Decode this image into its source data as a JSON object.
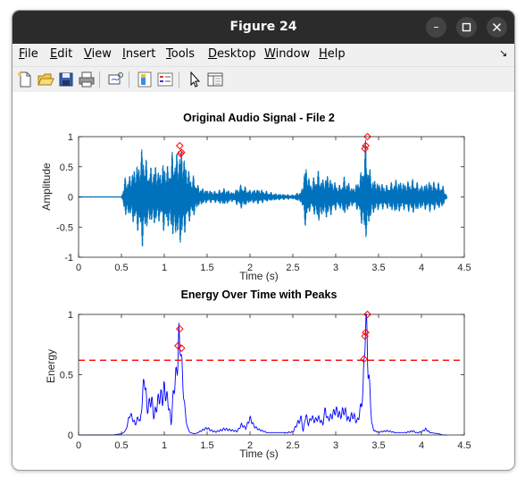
{
  "window": {
    "title": "Figure 24",
    "controls": {
      "minimize": "–",
      "maximize": "□",
      "close": "✕"
    }
  },
  "menu": {
    "items": [
      {
        "label": "File",
        "key": "F",
        "rest": "ile"
      },
      {
        "label": "Edit",
        "key": "E",
        "rest": "dit"
      },
      {
        "label": "View",
        "key": "V",
        "rest": "iew"
      },
      {
        "label": "Insert",
        "key": "I",
        "rest": "nsert"
      },
      {
        "label": "Tools",
        "key": "T",
        "rest": "ools"
      },
      {
        "label": "Desktop",
        "key": "D",
        "rest": "esktop"
      },
      {
        "label": "Window",
        "key": "W",
        "rest": "indow"
      },
      {
        "label": "Help",
        "key": "H",
        "rest": "elp"
      }
    ],
    "dock_arrow": "↘"
  },
  "toolbar": {
    "buttons": [
      "new-figure-icon",
      "open-file-icon",
      "save-icon",
      "print-icon",
      "link-plot-icon",
      "insert-colorbar-icon",
      "insert-legend-icon",
      "edit-plot-arrow-icon",
      "property-inspector-icon"
    ]
  },
  "colors": {
    "signal": "#0072bd",
    "energy": "#0000ff",
    "peaks": "#ff0000",
    "threshold": "#ff0000"
  },
  "chart_data": [
    {
      "type": "line",
      "title": "Original Audio Signal - File 2",
      "xlabel": "Time (s)",
      "ylabel": "Amplitude",
      "xlim": [
        0,
        4.5
      ],
      "ylim": [
        -1,
        1
      ],
      "xticks": [
        "0",
        "0.5",
        "1",
        "1.5",
        "2",
        "2.5",
        "3",
        "3.5",
        "4",
        "4.5"
      ],
      "yticks": [
        "-1",
        "-0.5",
        "0",
        "0.5",
        "1"
      ],
      "grid": false,
      "series": [
        {
          "envelope": {
            "t": [
              0,
              0.5,
              0.55,
              0.58,
              0.62,
              0.7,
              0.75,
              0.8,
              0.85,
              0.9,
              0.95,
              1.0,
              1.05,
              1.1,
              1.15,
              1.2,
              1.25,
              1.3,
              1.35,
              1.4,
              1.5,
              1.6,
              1.7,
              1.8,
              1.9,
              2.0,
              2.1,
              2.2,
              2.3,
              2.4,
              2.5,
              2.6,
              2.65,
              2.7,
              2.75,
              2.8,
              2.85,
              2.9,
              2.95,
              3.0,
              3.05,
              3.1,
              3.15,
              3.2,
              3.25,
              3.3,
              3.35,
              3.38,
              3.42,
              3.45,
              3.5,
              3.6,
              3.7,
              3.8,
              3.9,
              4.0,
              4.1,
              4.2,
              4.25,
              4.3,
              4.5
            ],
            "pos": [
              0.01,
              0.01,
              0.38,
              0.32,
              0.45,
              0.6,
              0.9,
              0.55,
              0.5,
              0.55,
              0.45,
              0.62,
              0.5,
              0.8,
              0.75,
              0.88,
              0.6,
              0.4,
              0.35,
              0.18,
              0.12,
              0.1,
              0.15,
              0.08,
              0.22,
              0.12,
              0.14,
              0.1,
              0.06,
              0.05,
              0.04,
              0.1,
              0.6,
              0.25,
              0.35,
              0.45,
              0.3,
              0.4,
              0.3,
              0.25,
              0.2,
              0.35,
              0.25,
              0.15,
              0.25,
              0.45,
              0.98,
              0.6,
              0.35,
              0.3,
              0.25,
              0.2,
              0.3,
              0.25,
              0.3,
              0.2,
              0.28,
              0.24,
              0.2,
              0.01,
              0.01
            ],
            "neg": [
              -0.01,
              -0.01,
              -0.35,
              -0.3,
              -0.4,
              -0.6,
              -0.88,
              -0.5,
              -0.45,
              -0.5,
              -0.4,
              -0.6,
              -0.5,
              -0.7,
              -0.7,
              -0.85,
              -0.55,
              -0.4,
              -0.32,
              -0.16,
              -0.1,
              -0.1,
              -0.14,
              -0.08,
              -0.2,
              -0.1,
              -0.12,
              -0.08,
              -0.06,
              -0.05,
              -0.04,
              -0.1,
              -0.55,
              -0.22,
              -0.3,
              -0.45,
              -0.3,
              -0.38,
              -0.3,
              -0.22,
              -0.2,
              -0.32,
              -0.22,
              -0.15,
              -0.22,
              -0.45,
              -0.75,
              -0.55,
              -0.3,
              -0.28,
              -0.22,
              -0.2,
              -0.28,
              -0.22,
              -0.28,
              -0.2,
              -0.25,
              -0.2,
              -0.18,
              -0.01,
              -0.01
            ]
          }
        }
      ],
      "peaks": [
        {
          "x": 1.18,
          "y": 0.85
        },
        {
          "x": 1.2,
          "y": 0.74
        },
        {
          "x": 1.19,
          "y": 0.72
        },
        {
          "x": 3.35,
          "y": 0.85
        },
        {
          "x": 3.37,
          "y": 1.0
        },
        {
          "x": 3.34,
          "y": 0.8
        }
      ]
    },
    {
      "type": "line",
      "title": "Energy Over Time with Peaks",
      "xlabel": "Time (s)",
      "ylabel": "Energy",
      "xlim": [
        0,
        4.5
      ],
      "ylim": [
        0,
        1
      ],
      "xticks": [
        "0",
        "0.5",
        "1",
        "1.5",
        "2",
        "2.5",
        "3",
        "3.5",
        "4",
        "4.5"
      ],
      "yticks": [
        "0",
        "0.5",
        "1"
      ],
      "grid": false,
      "threshold": 0.62,
      "series": [
        {
          "x": [
            0,
            0.4,
            0.5,
            0.55,
            0.58,
            0.6,
            0.63,
            0.66,
            0.7,
            0.72,
            0.75,
            0.77,
            0.8,
            0.82,
            0.85,
            0.88,
            0.9,
            0.92,
            0.95,
            0.98,
            1.0,
            1.02,
            1.05,
            1.08,
            1.1,
            1.12,
            1.14,
            1.16,
            1.17,
            1.18,
            1.19,
            1.2,
            1.22,
            1.24,
            1.27,
            1.3,
            1.35,
            1.4,
            1.5,
            1.55,
            1.6,
            1.7,
            1.8,
            1.85,
            1.9,
            1.95,
            2.0,
            2.05,
            2.1,
            2.2,
            2.3,
            2.4,
            2.5,
            2.55,
            2.6,
            2.62,
            2.65,
            2.68,
            2.72,
            2.75,
            2.8,
            2.85,
            2.88,
            2.9,
            2.95,
            3.0,
            3.05,
            3.1,
            3.15,
            3.2,
            3.25,
            3.28,
            3.3,
            3.32,
            3.33,
            3.34,
            3.35,
            3.36,
            3.37,
            3.38,
            3.4,
            3.42,
            3.45,
            3.5,
            3.6,
            3.7,
            3.8,
            3.9,
            3.95,
            4.0,
            4.05,
            4.1,
            4.2,
            4.25,
            4.3,
            4.5
          ],
          "y": [
            0,
            0,
            0.01,
            0.03,
            0.1,
            0.15,
            0.12,
            0.08,
            0.14,
            0.1,
            0.35,
            0.52,
            0.22,
            0.28,
            0.35,
            0.18,
            0.25,
            0.32,
            0.4,
            0.35,
            0.45,
            0.38,
            0.28,
            0.1,
            0.3,
            0.42,
            0.48,
            0.6,
            0.74,
            0.65,
            0.72,
            0.55,
            0.35,
            0.18,
            0.05,
            0.02,
            0.01,
            0.02,
            0.06,
            0.04,
            0.03,
            0.06,
            0.04,
            0.03,
            0.08,
            0.05,
            0.12,
            0.06,
            0.04,
            0.02,
            0.02,
            0.02,
            0.03,
            0.1,
            0.14,
            0.02,
            0.16,
            0.08,
            0.13,
            0.1,
            0.12,
            0.08,
            0.2,
            0.12,
            0.15,
            0.22,
            0.18,
            0.25,
            0.15,
            0.2,
            0.12,
            0.2,
            0.28,
            0.35,
            0.62,
            0.82,
            0.85,
            1.0,
            0.7,
            0.45,
            0.35,
            0.08,
            0.03,
            0.02,
            0.03,
            0.02,
            0.02,
            0.04,
            0.02,
            0.03,
            0.05,
            0.02,
            0.01,
            0,
            0,
            0
          ]
        }
      ],
      "peaks": [
        {
          "x": 1.18,
          "y": 0.88
        },
        {
          "x": 1.16,
          "y": 0.74
        },
        {
          "x": 1.2,
          "y": 0.72
        },
        {
          "x": 3.35,
          "y": 0.85
        },
        {
          "x": 3.37,
          "y": 1.0
        },
        {
          "x": 3.34,
          "y": 0.82
        },
        {
          "x": 3.33,
          "y": 0.63
        }
      ]
    }
  ]
}
